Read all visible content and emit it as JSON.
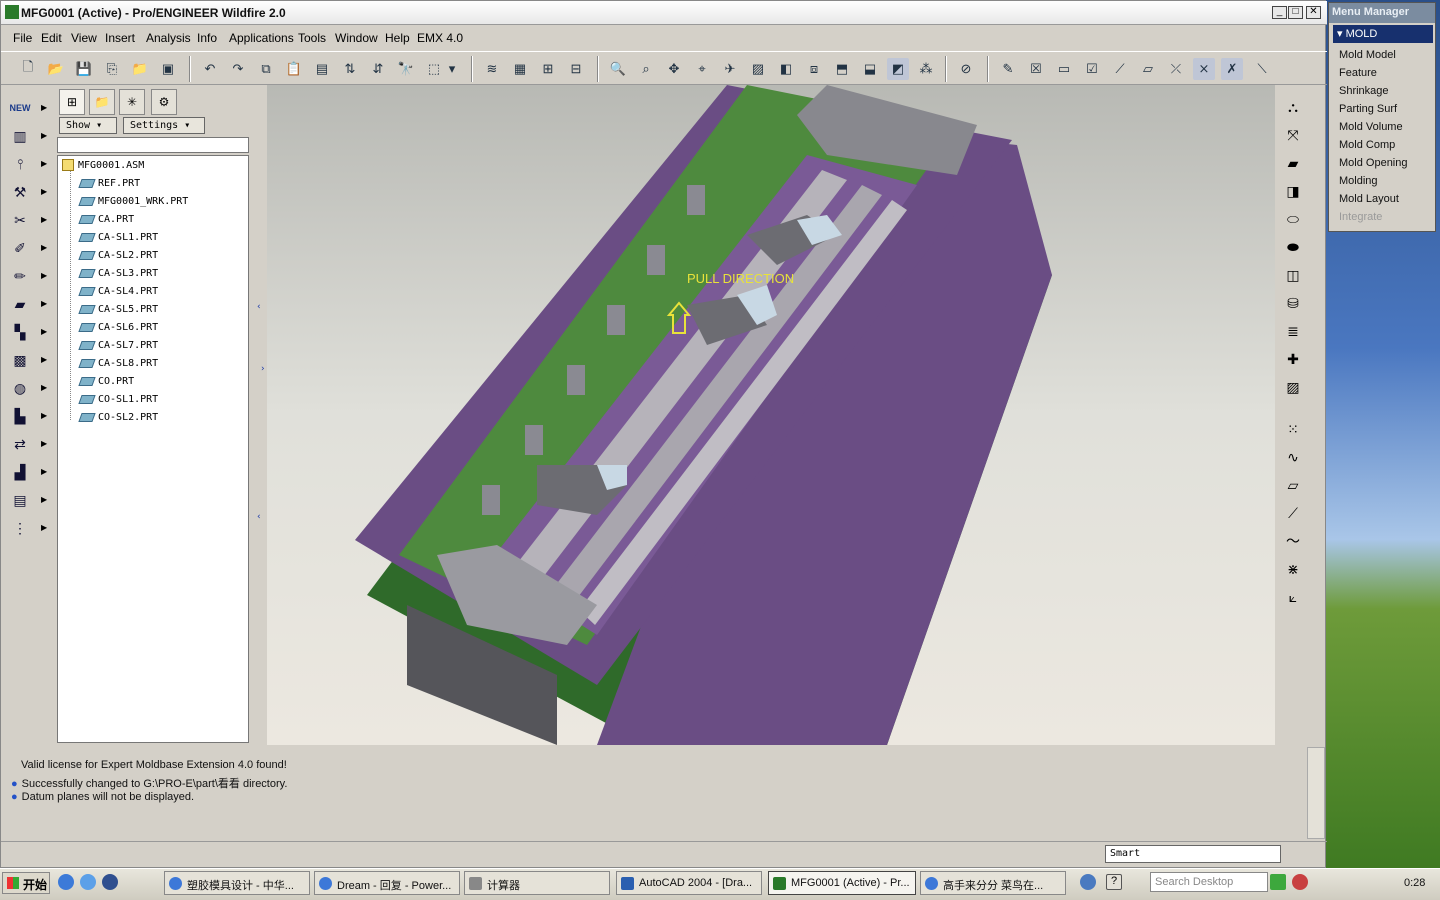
{
  "window": {
    "title": "MFG0001 (Active) - Pro/ENGINEER Wildfire 2.0",
    "min": "_",
    "max": "□",
    "close": "✕"
  },
  "menubar": [
    {
      "label": "File"
    },
    {
      "label": "Edit"
    },
    {
      "label": "View"
    },
    {
      "label": "Insert"
    },
    {
      "label": "Analysis"
    },
    {
      "label": "Info"
    },
    {
      "label": "Applications"
    },
    {
      "label": "Tools"
    },
    {
      "label": "Window"
    },
    {
      "label": "Help"
    },
    {
      "label": "EMX 4.0"
    }
  ],
  "navigator": {
    "show_label": "Show",
    "settings_label": "Settings",
    "root": "MFG0001.ASM",
    "items": [
      "REF.PRT",
      "MFG0001_WRK.PRT",
      "CA.PRT",
      "CA-SL1.PRT",
      "CA-SL2.PRT",
      "CA-SL3.PRT",
      "CA-SL4.PRT",
      "CA-SL5.PRT",
      "CA-SL6.PRT",
      "CA-SL7.PRT",
      "CA-SL8.PRT",
      "CO.PRT",
      "CO-SL1.PRT",
      "CO-SL2.PRT"
    ]
  },
  "viewport": {
    "annotation": "PULL DIRECTION",
    "colors": {
      "purple": "#6a4d84",
      "green": "#4e8a3e",
      "dark_green": "#2f6a2a",
      "grey": "#8a8a92"
    }
  },
  "messages": [
    {
      "bullet": false,
      "text": "Valid license for Expert Moldbase Extension 4.0 found!"
    },
    {
      "bullet": true,
      "text": "Successfully changed to G:\\PRO-E\\part\\看看 directory."
    },
    {
      "bullet": true,
      "text": "Datum planes will not be displayed."
    }
  ],
  "status": {
    "filter": "Smart"
  },
  "menu_manager": {
    "title": "Menu Manager",
    "header": "MOLD",
    "items": [
      {
        "label": "Mold Model",
        "enabled": true
      },
      {
        "label": "Feature",
        "enabled": true
      },
      {
        "label": "Shrinkage",
        "enabled": true
      },
      {
        "label": "Parting Surf",
        "enabled": true
      },
      {
        "label": "Mold Volume",
        "enabled": true
      },
      {
        "label": "Mold Comp",
        "enabled": true
      },
      {
        "label": "Mold Opening",
        "enabled": true
      },
      {
        "label": "Molding",
        "enabled": true
      },
      {
        "label": "Mold Layout",
        "enabled": true
      },
      {
        "label": "Integrate",
        "enabled": false
      }
    ]
  },
  "taskbar": {
    "start": "开始",
    "tasks": [
      "塑胶模具设计 - 中华...",
      "Dream - 回复 - Power...",
      "计算器",
      "AutoCAD 2004 - [Dra...",
      "MFG0001 (Active) - Pr...",
      "高手来分分 菜鸟在..."
    ],
    "search_placeholder": "Search Desktop",
    "clock": "0:28"
  }
}
